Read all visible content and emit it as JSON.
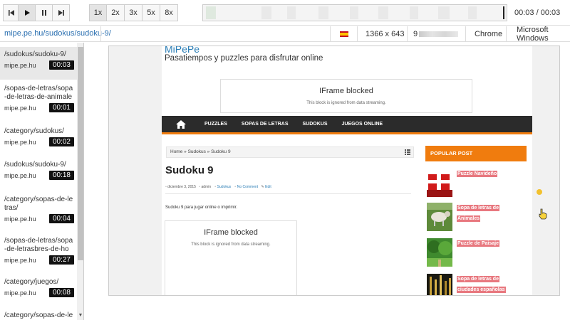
{
  "player": {
    "buttons": [
      "skip-back",
      "play",
      "pause",
      "skip-forward"
    ],
    "speeds": [
      "1x",
      "2x",
      "3x",
      "5x",
      "8x"
    ],
    "time": "00:03 / 00:03"
  },
  "info": {
    "url": "mipe.pe.hu/sudokus/sudoku-9/",
    "resolution": "1366 x 643",
    "ip_prefix": "9",
    "browser": "Chrome",
    "os": "Microsoft Windows"
  },
  "sidebar": {
    "items": [
      {
        "path": "/sudokus/sudoku-9/",
        "host": "mipe.pe.hu",
        "duration": "00:03"
      },
      {
        "path": "/sopas-de-letras/sopa-de-letras-de-animale",
        "host": "mipe.pe.hu",
        "duration": "00:01"
      },
      {
        "path": "/category/sudokus/",
        "host": "mipe.pe.hu",
        "duration": "00:02"
      },
      {
        "path": "/sudokus/sudoku-9/",
        "host": "mipe.pe.hu",
        "duration": "00:18"
      },
      {
        "path": "/category/sopas-de-letras/",
        "host": "mipe.pe.hu",
        "duration": "00:04"
      },
      {
        "path": "/sopas-de-letras/sopa-de-letrasbres-de-ho",
        "host": "mipe.pe.hu",
        "duration": "00:27"
      },
      {
        "path": "/category/juegos/",
        "host": "mipe.pe.hu",
        "duration": "00:08"
      },
      {
        "path": "/category/sopas-de-le",
        "host": "",
        "duration": ""
      }
    ]
  },
  "site": {
    "title": "MiPePe",
    "tagline": "Pasatiempos y puzzles para disfrutar online",
    "iframe_title": "IFrame blocked",
    "iframe_sub": "This block is ignored from data streaming.",
    "nav": [
      "PUZZLES",
      "SOPAS DE LETRAS",
      "SUDOKUS",
      "JUEGOS ONLINE"
    ],
    "breadcrumb": "Home » Sudokus » Sudoku 9",
    "post_title": "Sudoku 9",
    "meta": {
      "date": "diciembre 3, 2015",
      "author": "admin",
      "category": "Sudokus",
      "comments": "No Comment",
      "edit": "Edit"
    },
    "post_body": "Sudoku 9 para jugar online o imprimir.",
    "widget_title": "POPULAR POST",
    "popular": [
      {
        "lines": [
          "Puzzle Navideño"
        ],
        "thumb": "gift"
      },
      {
        "lines": [
          "Sopa de letras de",
          "Animales"
        ],
        "thumb": "sheep"
      },
      {
        "lines": [
          "Puzzle de Paisaje"
        ],
        "thumb": "park"
      },
      {
        "lines": [
          "Sopa de letras de",
          "ciudades españolas"
        ],
        "thumb": "city"
      }
    ]
  },
  "colors": {
    "accent": "#f07c0e",
    "nav_bg": "#2b2b2b",
    "link": "#2a7db5",
    "popular_highlight": "#e8787f"
  }
}
